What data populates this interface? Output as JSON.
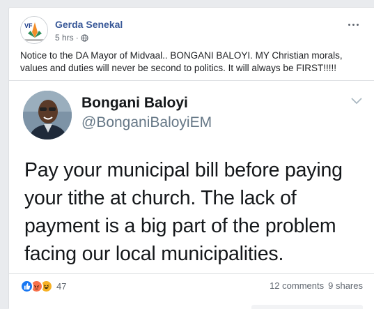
{
  "post": {
    "author": "Gerda Senekal",
    "time": "5 hrs",
    "separator": "·",
    "privacy_icon": "globe-icon",
    "text": "Notice to the DA Mayor of Midvaal.. BONGANI BALOYI. MY Christian morals, values and duties will never be second to politics. It will always be FIRST!!!!!",
    "avatar_lettering": "VF"
  },
  "tweet": {
    "name": "Bongani Baloyi",
    "handle": "@BonganiBaloyiEM",
    "body": "Pay your municipal bill before paying your tithe at church. The lack of payment is a big part of the problem facing our local municipalities."
  },
  "footer": {
    "reaction_count": "47",
    "comments": "12 comments",
    "shares": "9 shares",
    "reaction_icons": [
      "like-icon",
      "angry-icon",
      "haha-icon"
    ]
  },
  "colors": {
    "author": "#385898",
    "like": "#1877f2",
    "angry": "#f7714b",
    "haha": "#f7b125"
  }
}
